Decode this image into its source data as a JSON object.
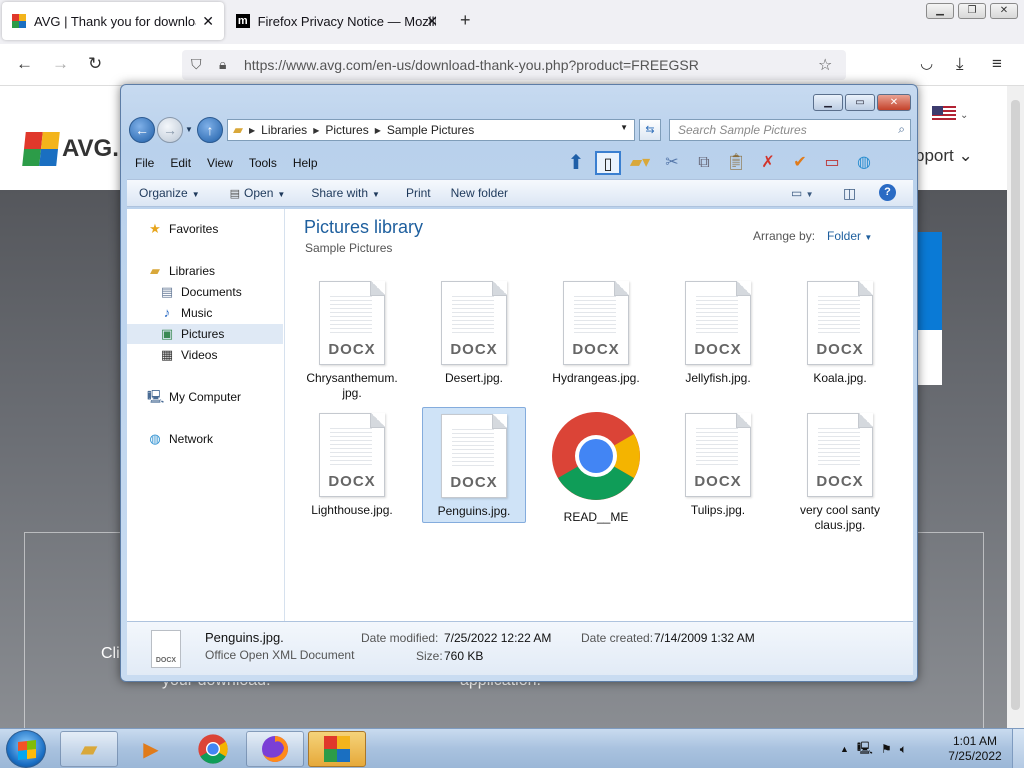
{
  "firefox": {
    "tabs": [
      {
        "title": "AVG | Thank you for downloadi",
        "close": "✕",
        "active": true
      },
      {
        "title": "Firefox Privacy Notice — Mozilla",
        "close": "✕",
        "active": false
      }
    ],
    "new_tab": "+",
    "url": "https://www.avg.com/en-us/download-thank-you.php?product=FREEGSR"
  },
  "webpage": {
    "logo_text": "AVG.",
    "support_text": "pport",
    "line_cli": "Cli",
    "line_download": "your download.",
    "line_application": "application."
  },
  "explorer": {
    "breadcrumb": [
      "Libraries",
      "Pictures",
      "Sample Pictures"
    ],
    "search_placeholder": "Search Sample Pictures",
    "menu": [
      "File",
      "Edit",
      "View",
      "Tools",
      "Help"
    ],
    "commands": {
      "organize": "Organize",
      "open": "Open",
      "share_with": "Share with",
      "print": "Print",
      "new_folder": "New folder"
    },
    "nav": {
      "favorites": "Favorites",
      "libraries": "Libraries",
      "documents": "Documents",
      "music": "Music",
      "pictures": "Pictures",
      "videos": "Videos",
      "my_computer": "My Computer",
      "network": "Network"
    },
    "library_title": "Pictures library",
    "library_subtitle": "Sample Pictures",
    "arrange_label": "Arrange by:",
    "arrange_value": "Folder",
    "icon_label": "DOCX",
    "files": [
      {
        "name": "Chrysanthemum.\njpg."
      },
      {
        "name": "Desert.jpg."
      },
      {
        "name": "Hydrangeas.jpg."
      },
      {
        "name": "Jellyfish.jpg."
      },
      {
        "name": "Koala.jpg."
      },
      {
        "name": "Lighthouse.jpg."
      },
      {
        "name": "Penguins.jpg."
      },
      {
        "name": "READ__ME"
      },
      {
        "name": "Tulips.jpg."
      },
      {
        "name": "very cool santy\nclaus.jpg."
      }
    ],
    "details": {
      "name": "Penguins.jpg.",
      "type": "Office Open XML Document",
      "modified_label": "Date modified:",
      "modified": "7/25/2022 12:22 AM",
      "created_label": "Date created:",
      "created": "7/14/2009 1:32 AM",
      "size_label": "Size:",
      "size": "760 KB",
      "icon_label": "DOCX"
    }
  },
  "taskbar": {
    "time": "1:01 AM",
    "date": "7/25/2022"
  },
  "colors": {
    "explorer_title": "#1e5f9e",
    "avg_blue": "#0a7ad6",
    "chrome_red": "#db4437",
    "chrome_yellow": "#f4b400",
    "chrome_green": "#0f9d58",
    "chrome_blue": "#4285f4"
  }
}
